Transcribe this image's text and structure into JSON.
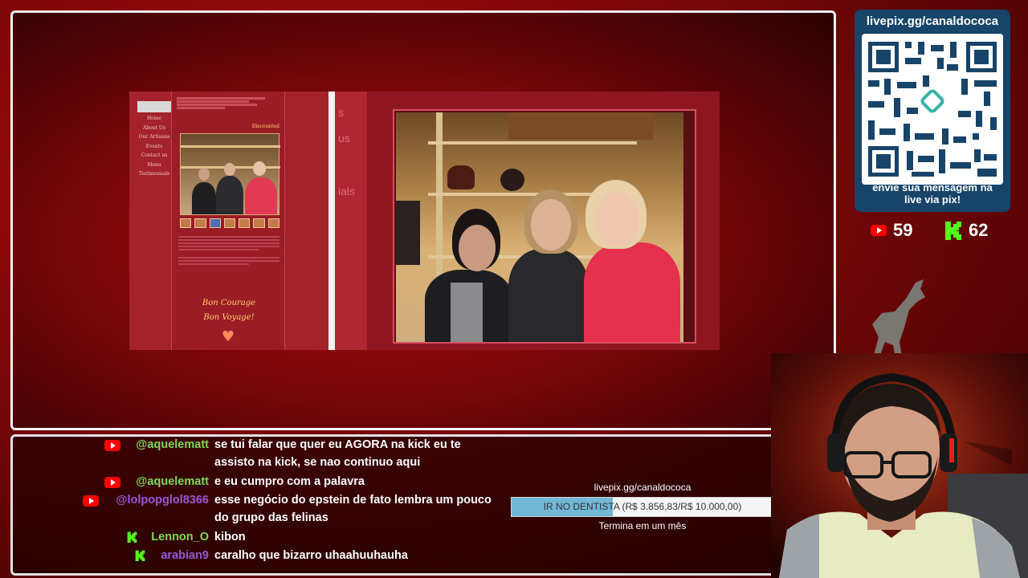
{
  "screen": {
    "site": {
      "nav": [
        "Home",
        "About Us",
        "Our Artisans",
        "Events",
        "Contact us",
        "Menu",
        "Testimonials"
      ],
      "discount_label": "Discounted",
      "sign_line1": "Bon Courage",
      "sign_line2": "Bon Voyage!"
    },
    "mid_pane_fragments": [
      "s",
      "us",
      "ials"
    ]
  },
  "donation": {
    "title": "livepix.gg/canaldococa",
    "caption_line1": "envie sua mensagem na",
    "caption_line2": "live via pix!"
  },
  "stats": {
    "youtube_count": "59",
    "kick_count": "62"
  },
  "chat": {
    "messages": [
      {
        "platform": "youtube",
        "user": "@aquelematt",
        "user_color": "#7fd85a",
        "text": "se tui falar que quer eu AGORA na kick eu te assisto na kick, se nao continuo aqui"
      },
      {
        "platform": "youtube",
        "user": "@aquelematt",
        "user_color": "#7fd85a",
        "text": "e eu cumpro com a palavra"
      },
      {
        "platform": "youtube",
        "user": "@lolpopglol8366",
        "user_color": "#9b59d6",
        "text": "esse negócio do epstein de fato lembra um pouco do grupo das felinas"
      },
      {
        "platform": "kick",
        "user": "Lennon_O",
        "user_color": "#7fd85a",
        "text": "kibon"
      },
      {
        "platform": "kick",
        "user": "arabian9",
        "user_color": "#9b59d6",
        "text": "caralho que bizarro uhaahuuhauha"
      }
    ]
  },
  "goal": {
    "link": "livepix.gg/canaldococa",
    "bar_text": "IR NO DENTISTA (R$ 3.856,83/R$ 10.000,00)",
    "progress": 0.3857,
    "footer": "Termina em um mês"
  }
}
